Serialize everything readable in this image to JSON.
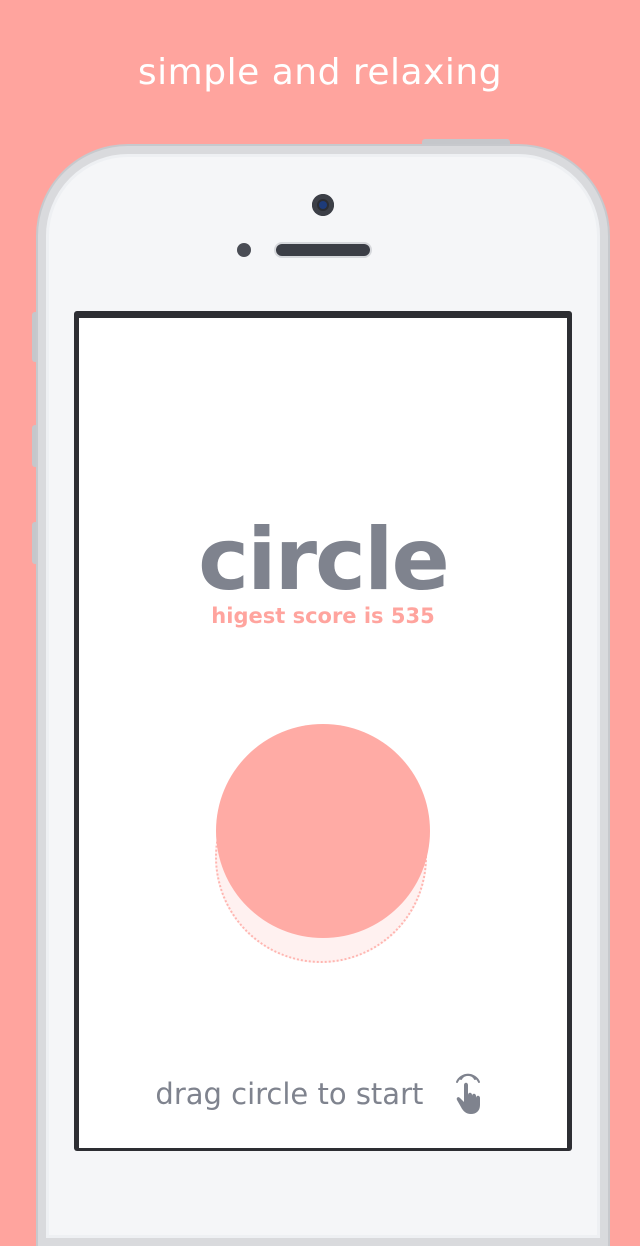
{
  "tagline": "simple and relaxing",
  "app": {
    "title": "circle",
    "highscore_text": "higest score is 535",
    "hint_text": "drag circle to start"
  },
  "icons": {
    "hint": "tap-hand-icon"
  },
  "colors": {
    "background": "#ffa49e",
    "title": "#7f838e",
    "accent": "#ffa49e",
    "circle": "#ffaba5"
  }
}
